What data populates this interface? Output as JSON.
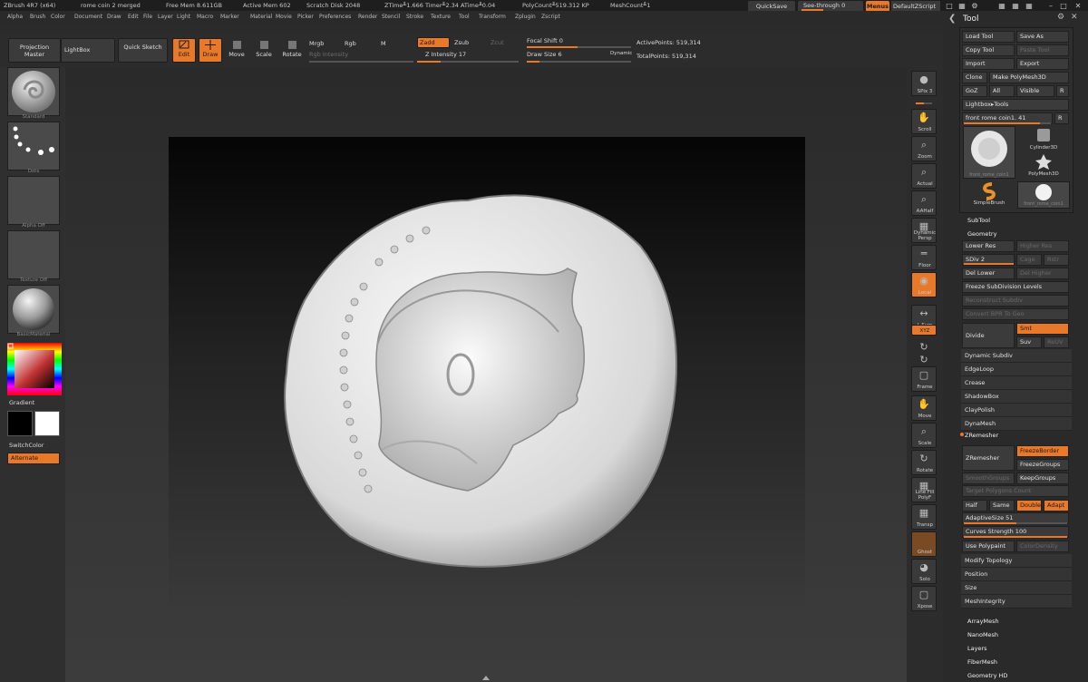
{
  "titlebar": {
    "app": "ZBrush 4R7 (x64)",
    "doc": "rome coin 2 merged",
    "free_mem": "Free Mem 8.611GB",
    "active_mem": "Active Mem 602",
    "scratch": "Scratch Disk 2048",
    "ztime": "ZTime╨1.666 Timer╨2.34 ATime╨0.04",
    "polycount": "PolyCount╨519.312 KP",
    "meshcount": "MeshCount╨1",
    "quicksave": "QuickSave",
    "see_through": "See-through  0",
    "menus": "Menus",
    "default_zscript": "DefaultZScript"
  },
  "menus": [
    "Alpha",
    "Brush",
    "Color",
    "Document",
    "Draw",
    "Edit",
    "File",
    "Layer",
    "Light",
    "Macro",
    "Marker",
    "Material",
    "Movie",
    "Picker",
    "Preferences",
    "Render",
    "Stencil",
    "Stroke",
    "Texture",
    "Tool",
    "Transform",
    "Zplugin",
    "Zscript"
  ],
  "shelf": {
    "projection_master": "Projection Master",
    "lightbox": "LightBox",
    "quick_sketch": "Quick Sketch",
    "edit": "Edit",
    "draw": "Draw",
    "move": "Move",
    "scale": "Scale",
    "rotate": "Rotate",
    "mrgb": "Mrgb",
    "rgb": "Rgb",
    "m": "M",
    "rgb_intensity": "Rgb Intensity",
    "zadd": "Zadd",
    "zsub": "Zsub",
    "zcut": "Zcut",
    "z_intensity": "Z Intensity 17",
    "focal_shift": "Focal Shift 0",
    "draw_size": "Draw Size 6",
    "dynamic": "Dynamic",
    "active_points": "ActivePoints: 519,314",
    "total_points": "TotalPoints: 519,314"
  },
  "left": {
    "standard": "Standard",
    "dots": "Dots",
    "alpha_off": "Alpha Off",
    "texture_off": "Texture Off",
    "material": "BasicMaterial",
    "gradient": "Gradient",
    "switch_color": "SwitchColor",
    "alternate": "Alternate"
  },
  "rightstrip": [
    "SPix 3",
    "Scroll",
    "Zoom",
    "Actual",
    "AAHalf",
    "Dynamic Persp",
    "Floor",
    "Local",
    "L.Sym",
    "XYZ",
    "",
    "",
    "Frame",
    "Move",
    "Scale",
    "Rotate",
    "Line Fill PolyF",
    "Transp",
    "Ghost",
    "Solo",
    "Xpose"
  ],
  "palette": {
    "title": "Tool",
    "load_tool": "Load Tool",
    "save_as": "Save As",
    "copy_tool": "Copy Tool",
    "paste_tool": "Paste Tool",
    "import": "Import",
    "export": "Export",
    "clone": "Clone",
    "make_polymesh": "Make PolyMesh3D",
    "goz": "GoZ",
    "all": "All",
    "visible": "Visible",
    "r": "R",
    "lightbox_tools": "Lightbox▸Tools",
    "current_tool": "front rome coin1. 41",
    "thumb_main": "front_rome_coin1",
    "thumb_cyl": "Cylinder3D",
    "thumb_poly": "PolyMesh3D",
    "thumb_simple": "SimpleBrush",
    "thumb_front": "front_rome_coin1",
    "subtool": "SubTool",
    "geometry": "Geometry",
    "lower_res": "Lower Res",
    "higher_res": "Higher Res",
    "sdiv": "SDiv 2",
    "cage": "Cage",
    "rstr": "Rstr",
    "del_lower": "Del Lower",
    "del_higher": "Del Higher",
    "freeze_subdiv": "Freeze SubDivision Levels",
    "reconstruct": "Reconstruct Subdiv",
    "convert_bpr": "Convert BPR To Geo",
    "divide": "Divide",
    "smt": "Smt",
    "suv": "Suv",
    "reuv": "ReUV",
    "dynamic_subdiv": "Dynamic Subdiv",
    "edgeloop": "EdgeLoop",
    "crease": "Crease",
    "shadowbox": "ShadowBox",
    "claypolish": "ClayPolish",
    "dynamesh": "DynaMesh",
    "zremesher_head": "ZRemesher",
    "zremesher": "ZRemesher",
    "freezeborder": "FreezeBorder",
    "freezegroups": "FreezeGroups",
    "smoothgroups": "SmoothGroups",
    "keepgroups": "KeepGroups",
    "target_poly": "Target Polygons Count",
    "half": "Half",
    "same": "Same",
    "double": "Double",
    "adapt": "Adapt",
    "adaptive_size": "AdaptiveSize 51",
    "curves_strength": "Curves Strength 100",
    "use_polypaint": "Use Polypaint",
    "colordensity": "ColorDensity",
    "modify_topology": "Modify Topology",
    "position": "Position",
    "size": "Size",
    "meshintegrity": "MeshIntegrity",
    "arraymesh": "ArrayMesh",
    "nanomesh": "NanoMesh",
    "layers": "Layers",
    "fibermesh": "FiberMesh",
    "geometry_hd": "Geometry HD"
  },
  "colors": {
    "accent": "#e8782a",
    "panel": "#2a2a2a",
    "button": "#3b3b3b"
  }
}
